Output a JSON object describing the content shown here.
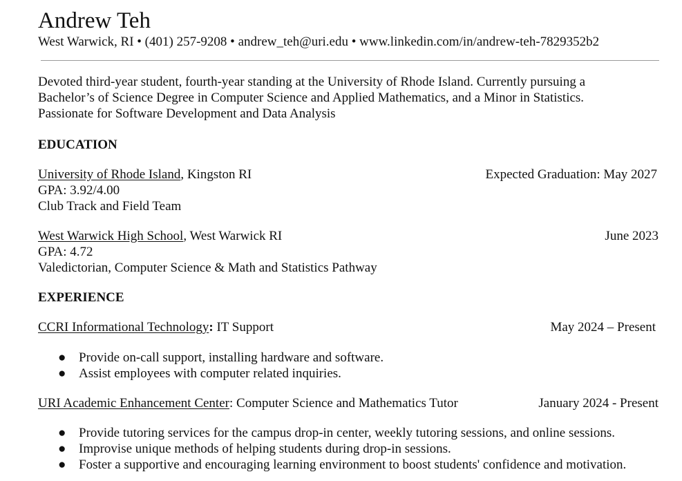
{
  "header": {
    "name": "Andrew Teh",
    "contact": "West Warwick, RI  • (401) 257-9208 • andrew_teh@uri.edu • www.linkedin.com/in/andrew-teh-7829352b2"
  },
  "summary": [
    "Devoted third-year student, fourth-year standing at the University of Rhode Island.  Currently pursuing a",
    "Bachelor’s of Science Degree in Computer Science and Applied Mathematics, and a Minor in Statistics.",
    "Passionate for Software Development and Data Analysis"
  ],
  "education": {
    "heading": "EDUCATION",
    "entries": [
      {
        "institution": "University of Rhode Island",
        "location": ", Kingston RI",
        "date": "Expected Graduation: May 2027",
        "details": [
          "GPA: 3.92/4.00",
          "Club Track and Field Team"
        ]
      },
      {
        "institution": "West Warwick High School",
        "location": ", West Warwick RI",
        "date": "June 2023",
        "details": [
          "GPA: 4.72",
          "Valedictorian, Computer Science & Math and Statistics Pathway"
        ]
      }
    ]
  },
  "experience": {
    "heading": "EXPERIENCE",
    "entries": [
      {
        "org": "CCRI Informational Technology",
        "sep": ":",
        "role": " IT Support",
        "date": "May 2024 – Present",
        "bullet": "●",
        "bullets": [
          "Provide on-call support, installing hardware and software.",
          "Assist employees with computer related inquiries."
        ]
      },
      {
        "org": "URI Academic Enhancement Center",
        "sep": ":",
        "role": " Computer Science and Mathematics Tutor",
        "date": "January 2024 - Present",
        "bullet": "●",
        "bullets": [
          "Provide tutoring services for the campus drop-in center, weekly tutoring sessions, and online sessions.",
          "Improvise unique methods of helping students during drop-in sessions.",
          "Foster a supportive and encouraging learning environment to boost students' confidence and motivation."
        ]
      }
    ]
  }
}
